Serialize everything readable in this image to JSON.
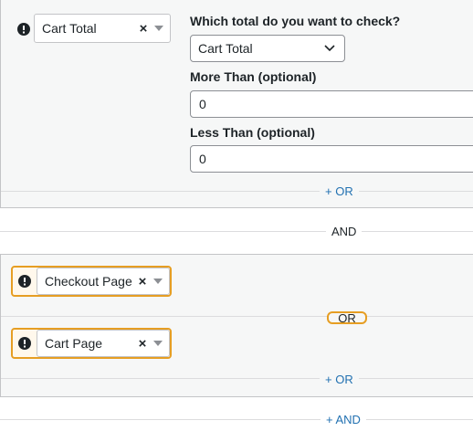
{
  "group1": {
    "condition": {
      "label": "Cart Total"
    },
    "fields": {
      "total_question": "Which total do you want to check?",
      "total_selected": "Cart Total",
      "more_than_label": "More Than (optional)",
      "more_than_value": "0",
      "less_than_label": "Less Than (optional)",
      "less_than_value": "0"
    },
    "add_or": "+ OR"
  },
  "and_separator": "AND",
  "group2": {
    "conditions": [
      {
        "label": "Checkout Page"
      },
      {
        "label": "Cart Page"
      }
    ],
    "or_divider": "OR",
    "add_or": "+ OR"
  },
  "add_and": "+ AND",
  "colors": {
    "highlight_border": "#e69e23",
    "link": "#2271b1",
    "group_background": "#f6f7f7"
  },
  "icons": {
    "warning": "exclamation-circle-icon",
    "clear": "times-icon",
    "dropdown": "chevron-down-icon"
  }
}
